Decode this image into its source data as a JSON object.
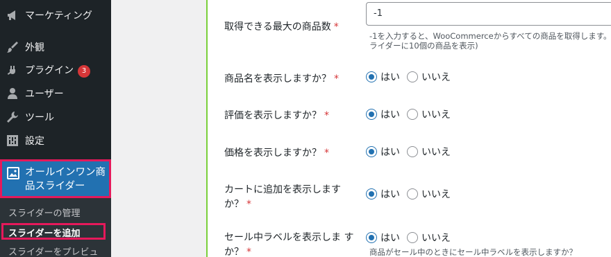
{
  "sidebar": {
    "items": [
      {
        "label": "マーケティング",
        "icon": "megaphone-icon"
      },
      {
        "label": "外観",
        "icon": "paintbrush-icon"
      },
      {
        "label": "プラグイン",
        "icon": "plug-icon",
        "badge": "3"
      },
      {
        "label": "ユーザー",
        "icon": "user-icon"
      },
      {
        "label": "ツール",
        "icon": "wrench-icon"
      },
      {
        "label": "設定",
        "icon": "settings-icon"
      }
    ],
    "active": {
      "label_line1": "オールインワン商",
      "label_line2": "品スライダー",
      "icon": "image-icon"
    },
    "submenu": [
      "スライダーの管理",
      "スライダーを追加",
      "スライダーをプレビュ"
    ]
  },
  "form": {
    "max_products": {
      "label": "取得できる最大の商品数",
      "required": "*",
      "value": "-1",
      "desc_line1": "-1を入力すると、WooCommerceからすべての商品を取得します。",
      "desc_line2": "ライダーに10個の商品を表示)"
    },
    "yes": "はい",
    "no": "いいえ",
    "rows": [
      {
        "label": "商品名を表示しますか？"
      },
      {
        "label": "評価を表示しますか？"
      },
      {
        "label": "価格を表示しますか？"
      },
      {
        "label_line1": "カートに追加を表示します",
        "label_line2": "か？"
      },
      {
        "label_line1": "セール中ラベルを表示しま す",
        "label_line2": "か？",
        "desc": "商品がセール中のときにセール中ラベルを表示しますか？"
      }
    ]
  },
  "colors": {
    "sidebar_bg": "#1d2327",
    "accent": "#2271b1",
    "highlight": "#e6195b",
    "badge": "#d63638"
  }
}
